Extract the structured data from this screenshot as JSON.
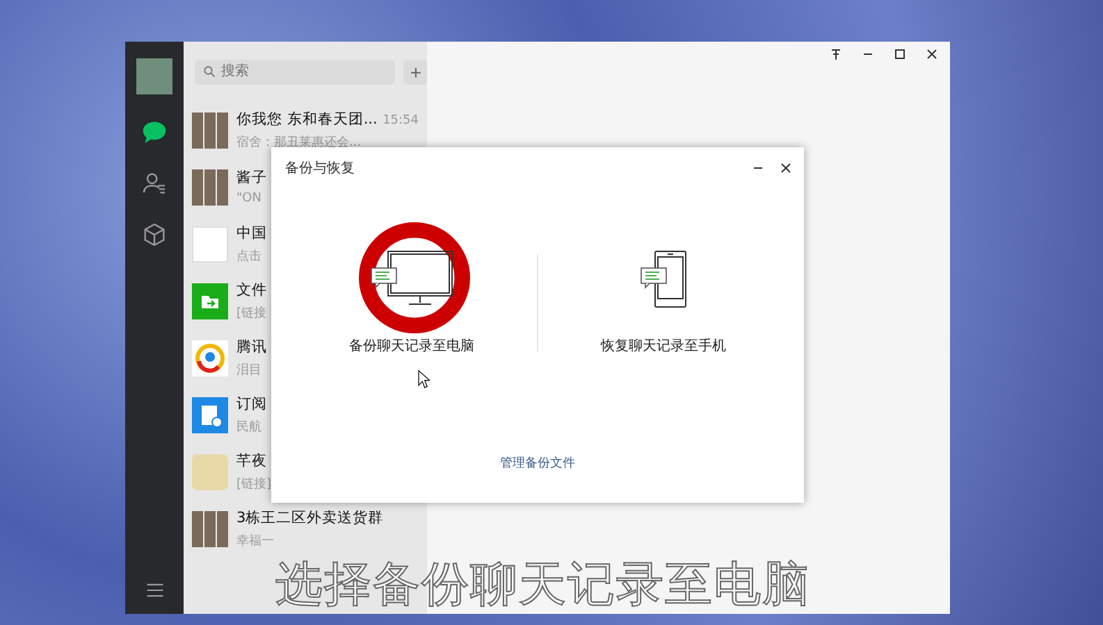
{
  "sidebar": {
    "items": [
      {
        "kind": "chat",
        "selected": true
      },
      {
        "kind": "contacts",
        "selected": false
      },
      {
        "kind": "cube",
        "selected": false
      }
    ]
  },
  "search": {
    "placeholder": "搜索",
    "add_label": "+"
  },
  "chats": [
    {
      "kind": "grid",
      "title": "你我您 东和春天团...",
      "preview": "宿舍：那丑莱惠还会...",
      "time": "15:54"
    },
    {
      "kind": "grid",
      "title": "酱子",
      "preview": "\"ON"
    },
    {
      "kind": "mobile",
      "title": "中国",
      "preview": "点击"
    },
    {
      "kind": "folder",
      "title": "文件",
      "preview": "[链接"
    },
    {
      "kind": "news",
      "title": "腾讯",
      "preview": "泪目"
    },
    {
      "kind": "doc",
      "title": "订阅",
      "preview": "民航"
    },
    {
      "kind": "cartoon",
      "title": "芊夜",
      "preview": "[链接]"
    },
    {
      "kind": "grid",
      "title": "3栋王二区外卖送货群",
      "preview": "幸福一"
    }
  ],
  "dialog": {
    "title": "备份与恢复",
    "options": [
      {
        "kind": "computer",
        "label": "备份聊天记录至电脑",
        "highlighted": true
      },
      {
        "kind": "phone",
        "label": "恢复聊天记录至手机",
        "highlighted": false
      }
    ],
    "link": "管理备份文件"
  },
  "caption": "选择备份聊天记录至电脑"
}
